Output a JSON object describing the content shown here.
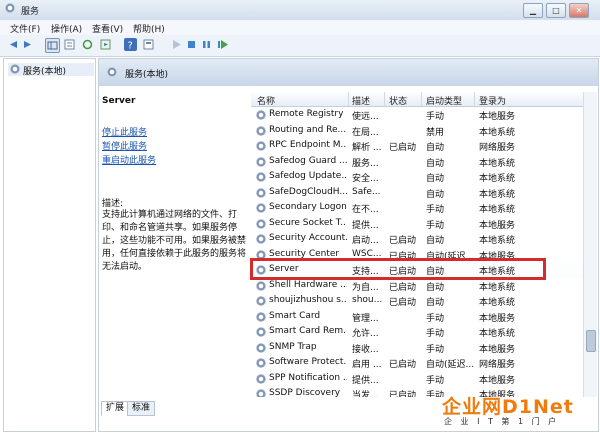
{
  "window": {
    "title": "服务"
  },
  "menu": [
    "文件(F)",
    "操作(A)",
    "查看(V)",
    "帮助(H)"
  ],
  "tree": {
    "root_label": "服务(本地)"
  },
  "pane": {
    "header_title": "服务(本地)",
    "selected_name": "Server",
    "links": [
      "停止此服务",
      "暂停此服务",
      "重启动此服务"
    ],
    "desc_label": "描述:",
    "description": "支持此计算机通过网络的文件、打印、和命名管道共享。如果服务停止，这些功能不可用。如果服务被禁用，任何直接依赖于此服务的服务将无法启动。"
  },
  "columns": [
    "名称",
    "描述",
    "状态",
    "启动类型",
    "登录为"
  ],
  "services": [
    {
      "name": "Remote Registry",
      "desc": "使远...",
      "status": "",
      "startup": "手动",
      "logon": "本地服务"
    },
    {
      "name": "Routing and Re...",
      "desc": "在局...",
      "status": "",
      "startup": "禁用",
      "logon": "本地系统"
    },
    {
      "name": "RPC Endpoint M...",
      "desc": "解析 ...",
      "status": "已启动",
      "startup": "自动",
      "logon": "网络服务"
    },
    {
      "name": "Safedog Guard ...",
      "desc": "服务...",
      "status": "",
      "startup": "自动",
      "logon": "本地系统"
    },
    {
      "name": "Safedog Update...",
      "desc": "安全...",
      "status": "",
      "startup": "自动",
      "logon": "本地系统"
    },
    {
      "name": "SafeDogCloudH...",
      "desc": "Safe...",
      "status": "",
      "startup": "自动",
      "logon": "本地系统"
    },
    {
      "name": "Secondary Logon",
      "desc": "在不...",
      "status": "",
      "startup": "手动",
      "logon": "本地系统"
    },
    {
      "name": "Secure Socket T...",
      "desc": "提供...",
      "status": "",
      "startup": "手动",
      "logon": "本地服务"
    },
    {
      "name": "Security Account...",
      "desc": "启动...",
      "status": "已启动",
      "startup": "自动",
      "logon": "本地系统"
    },
    {
      "name": "Security Center",
      "desc": "WSC...",
      "status": "已启动",
      "startup": "自动(延迟...",
      "logon": "本地服务"
    },
    {
      "name": "Server",
      "desc": "支持...",
      "status": "已启动",
      "startup": "自动",
      "logon": "本地系统"
    },
    {
      "name": "Shell Hardware ...",
      "desc": "为自...",
      "status": "已启动",
      "startup": "自动",
      "logon": "本地系统"
    },
    {
      "name": "shoujizhushou s...",
      "desc": "shou...",
      "status": "已启动",
      "startup": "自动",
      "logon": "本地系统"
    },
    {
      "name": "Smart Card",
      "desc": "管理...",
      "status": "",
      "startup": "手动",
      "logon": "本地服务"
    },
    {
      "name": "Smart Card Rem...",
      "desc": "允许...",
      "status": "",
      "startup": "手动",
      "logon": "本地系统"
    },
    {
      "name": "SNMP Trap",
      "desc": "接收...",
      "status": "",
      "startup": "手动",
      "logon": "本地服务"
    },
    {
      "name": "Software Protect...",
      "desc": "启用 ...",
      "status": "已启动",
      "startup": "自动(延迟...",
      "logon": "网络服务"
    },
    {
      "name": "SPP Notification ...",
      "desc": "提供...",
      "status": "",
      "startup": "手动",
      "logon": "本地服务"
    },
    {
      "name": "SSDP Discovery",
      "desc": "当发...",
      "status": "已启动",
      "startup": "手动",
      "logon": "本地服务"
    }
  ],
  "selected_index": 10,
  "tabs": [
    "扩展",
    "标准"
  ],
  "watermark": {
    "main": "企业网D1Net",
    "sub": "企 业 I T 第 1 门 户"
  },
  "colors": {
    "highlight": "#d42b2b",
    "link": "#1a55b0",
    "watermark": "#f07b0d"
  }
}
